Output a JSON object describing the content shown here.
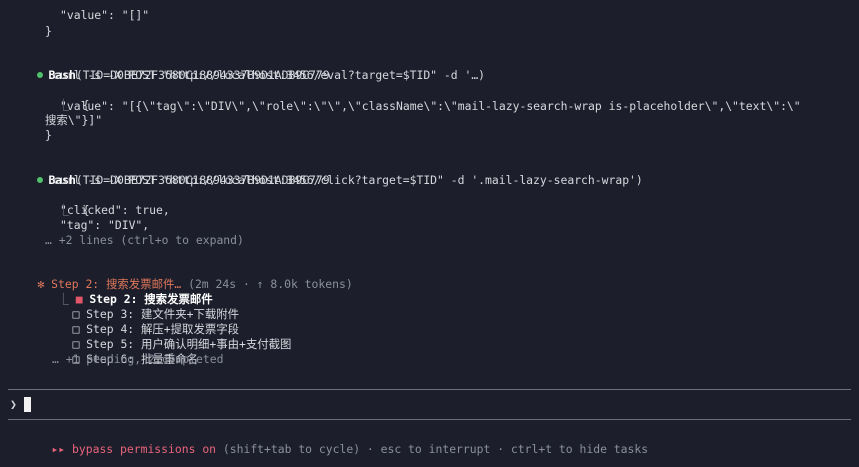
{
  "output1": {
    "value_line": "\"value\": \"[]\"",
    "close_brace": "}"
  },
  "bash1": {
    "tool": "Bash",
    "args": "(TID=D0BE72F3680C18894337B9D1ADB9C779",
    "cmd": "curl -s -X POST \"http://localhost:3456/eval?target=$TID\" -d '…)",
    "open_brace": "{",
    "value_line": "\"value\": \"[{\\\"tag\\\":\\\"DIV\\\",\\\"role\\\":\\\"\\\",\\\"className\\\":\\\"mail-lazy-search-wrap is-placeholder\\\",\\\"text\\\":\\\"",
    "value_line2": "搜索\\\"}]\"",
    "close_brace": "}"
  },
  "bash2": {
    "tool": "Bash",
    "args": "(TID=D0BE72F3680C18894337B9D1ADB9C779",
    "cmd": "curl -s -X POST \"http://localhost:3456/click?target=$TID\" -d '.mail-lazy-search-wrap')",
    "open_brace": "{",
    "clicked_line": "\"clicked\": true,",
    "tag_line": "\"tag\": \"DIV\",",
    "more_lines": "… +2 lines (ctrl+o to expand)"
  },
  "status": {
    "spinner": "✻",
    "label": "Step 2: 搜索发票邮件…",
    "meta": "(2m 24s · ↑ 8.0k tokens)"
  },
  "tasks": {
    "items": [
      {
        "box": "■",
        "label": "Step 2: 搜索发票邮件",
        "active": true
      },
      {
        "box": "□",
        "label": "Step 3: 建文件夹+下载附件",
        "active": false
      },
      {
        "box": "□",
        "label": "Step 4: 解压+提取发票字段",
        "active": false
      },
      {
        "box": "□",
        "label": "Step 5: 用户确认明细+事由+支付截图",
        "active": false
      },
      {
        "box": "□",
        "label": "Step 6: 批量重命名",
        "active": false
      }
    ],
    "summary": "… +1 pending, 2 completed"
  },
  "prompt": {
    "symbol": "❯",
    "value": ""
  },
  "footer": {
    "arrows": "▸▸",
    "mode": "bypass permissions on",
    "hint": "(shift+tab to cycle) · esc to interrupt · ctrl+t to hide tasks"
  },
  "tree_branch": "⎿"
}
